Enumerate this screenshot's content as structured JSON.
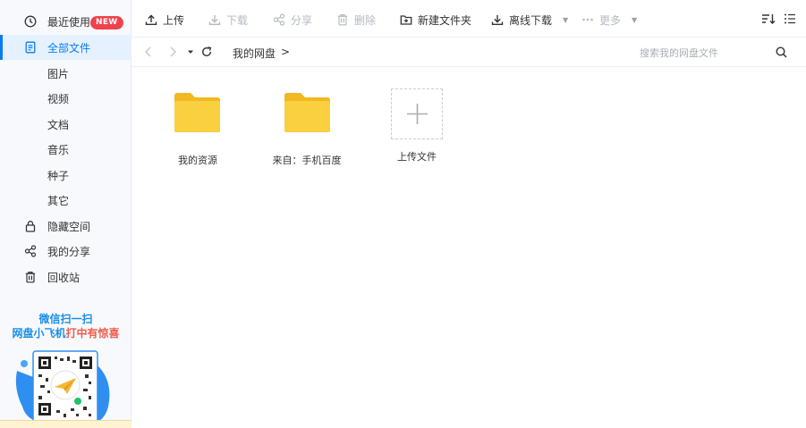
{
  "sidebar": {
    "items": [
      {
        "label": "最近使用",
        "badge": "NEW"
      },
      {
        "label": "全部文件"
      },
      {
        "label": "图片"
      },
      {
        "label": "视频"
      },
      {
        "label": "文档"
      },
      {
        "label": "音乐"
      },
      {
        "label": "种子"
      },
      {
        "label": "其它"
      },
      {
        "label": "隐藏空间"
      },
      {
        "label": "我的分享"
      },
      {
        "label": "回收站"
      }
    ],
    "promo": {
      "line1": "微信扫一扫",
      "line2_a": "网盘小飞机",
      "line2_b": "打中有惊喜"
    }
  },
  "toolbar": {
    "upload": "上传",
    "download": "下载",
    "share": "分享",
    "delete": "删除",
    "new_folder": "新建文件夹",
    "offline_download": "离线下载",
    "more": "更多"
  },
  "address": {
    "crumb": "我的网盘",
    "separator": ">",
    "search_placeholder": "搜索我的网盘文件"
  },
  "files": [
    {
      "name": "我的资源"
    },
    {
      "name": "来自：手机百度"
    }
  ],
  "upload_tile": {
    "label": "上传文件"
  },
  "colors": {
    "accent": "#0a7cef",
    "folder": "#f9c932",
    "badge": "#f0424c"
  }
}
